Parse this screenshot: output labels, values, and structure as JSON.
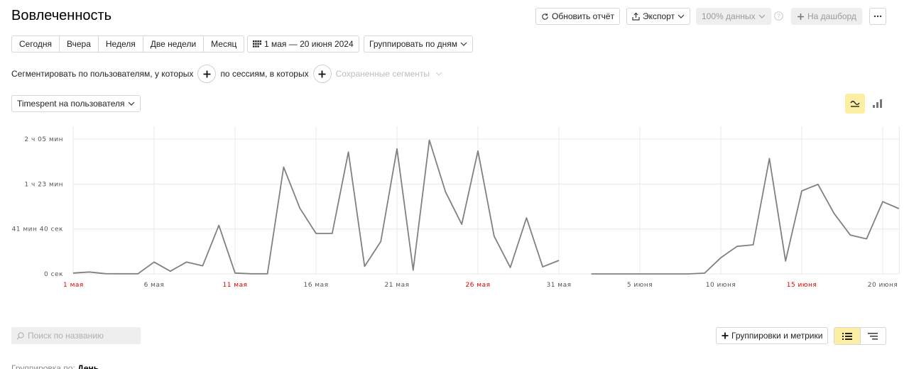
{
  "header": {
    "title": "Вовлеченность",
    "refresh_label": "Обновить отчёт",
    "export_label": "Экспорт",
    "sampling_label": "100% данных",
    "dashboard_label": "На дашборд"
  },
  "period": {
    "presets": [
      "Сегодня",
      "Вчера",
      "Неделя",
      "Две недели",
      "Месяц"
    ],
    "date_range": "1 мая — 20 июня 2024",
    "group_by": "Группировать по дням"
  },
  "segments": {
    "by_users_label": "Сегментировать по пользователям, у которых",
    "by_sessions_label": "по сессиям, в которых",
    "saved_label": "Сохраненные сегменты"
  },
  "metric_select": "Timespent на пользователя",
  "table_controls": {
    "search_placeholder": "Поиск по названию",
    "groupings_label": "Группировки и метрики",
    "grouping_prefix": "Группировка по:",
    "grouping_value": "День"
  },
  "colors": {
    "line": "#808080",
    "weekend_tick": "#e00000",
    "active_toggle": "#fcefa3",
    "grid": "#e8e8e8"
  },
  "chart_data": {
    "type": "line",
    "y_unit": "минуты",
    "ylim": [
      0,
      125
    ],
    "y_ticks": [
      {
        "value": 0,
        "label": "0 сек"
      },
      {
        "value": 41.67,
        "label": "41 мин 40 сек"
      },
      {
        "value": 83.33,
        "label": "1 ч 23 мин"
      },
      {
        "value": 125,
        "label": "2 ч 05 мин"
      }
    ],
    "x_labels": [
      {
        "day": 0,
        "label": "1 мая",
        "weekend": true
      },
      {
        "day": 5,
        "label": "6 мая",
        "weekend": false
      },
      {
        "day": 10,
        "label": "11 мая",
        "weekend": true
      },
      {
        "day": 15,
        "label": "16 мая",
        "weekend": false
      },
      {
        "day": 20,
        "label": "21 мая",
        "weekend": false
      },
      {
        "day": 25,
        "label": "26 мая",
        "weekend": true
      },
      {
        "day": 30,
        "label": "31 мая",
        "weekend": false
      },
      {
        "day": 35,
        "label": "5 июня",
        "weekend": false
      },
      {
        "day": 40,
        "label": "10 июня",
        "weekend": false
      },
      {
        "day": 45,
        "label": "15 июня",
        "weekend": true
      },
      {
        "day": 50,
        "label": "20 июня",
        "weekend": false
      }
    ],
    "series": [
      {
        "values": [
          0.8,
          1.8,
          0.2,
          0.1,
          0.1,
          11,
          2.5,
          11,
          7.5,
          45,
          0.8,
          0.1,
          0.1,
          99,
          61,
          37.5,
          37.5,
          113,
          7,
          30,
          116,
          3.5,
          124,
          76,
          46,
          114,
          35,
          6,
          52,
          6.5,
          12.5,
          null,
          0,
          0,
          0,
          0,
          0,
          0,
          0,
          0.7,
          15,
          25.5,
          27,
          107,
          12,
          77,
          83,
          56,
          36,
          32.5,
          67,
          60.5
        ]
      }
    ]
  }
}
